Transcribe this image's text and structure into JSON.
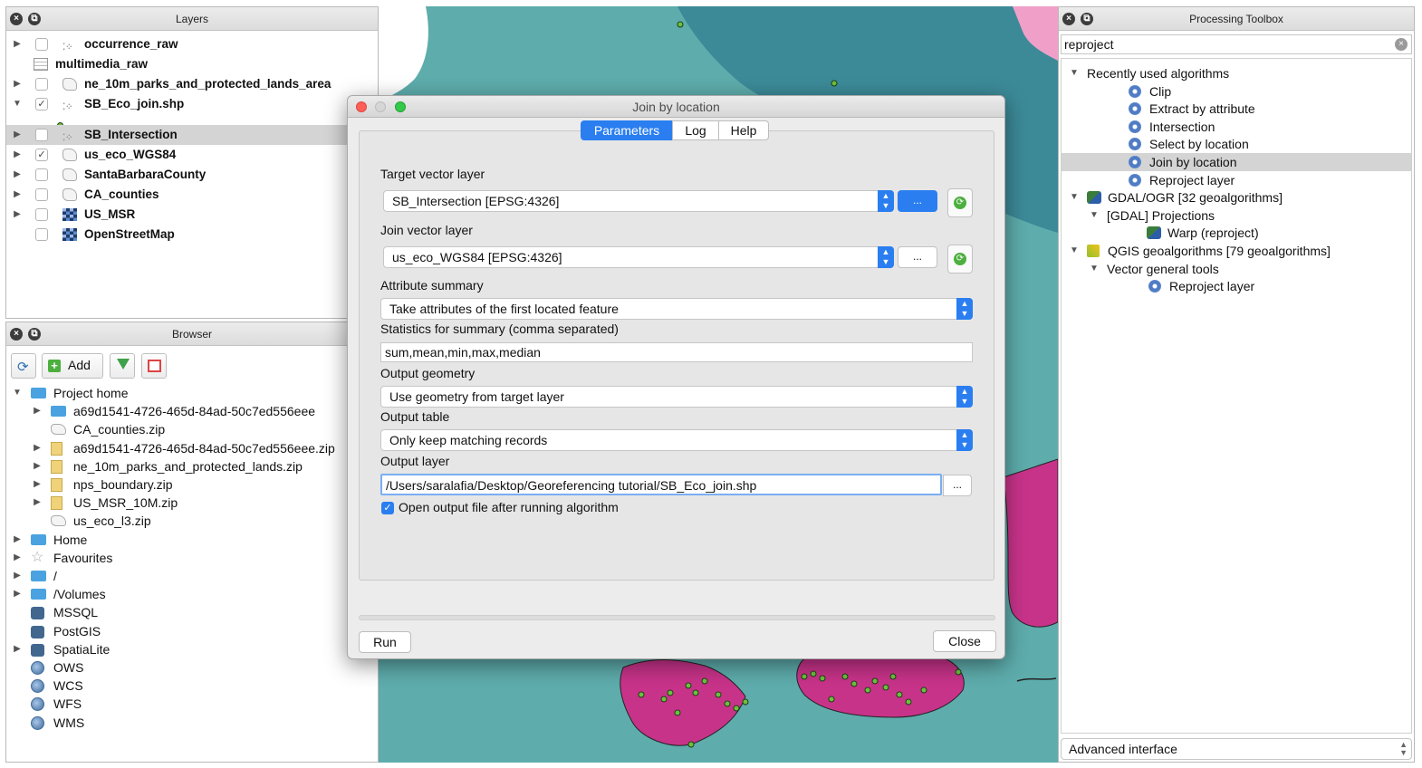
{
  "layers_panel": {
    "title": "Layers",
    "items": [
      {
        "name": "occurrence_raw",
        "checked": false,
        "expander": "▶",
        "icon": "point-layer-icon"
      },
      {
        "name": "multimedia_raw",
        "checked": null,
        "expander": "",
        "icon": "table-layer-icon"
      },
      {
        "name": "ne_10m_parks_and_protected_lands_area",
        "checked": false,
        "expander": "▶",
        "icon": "polygon-layer-icon"
      },
      {
        "name": "SB_Eco_join.shp",
        "checked": true,
        "expander": "▼",
        "icon": "point-layer-icon"
      },
      {
        "name": "SB_Intersection",
        "checked": false,
        "expander": "▶",
        "icon": "point-layer-icon",
        "selected": true
      },
      {
        "name": "us_eco_WGS84",
        "checked": true,
        "expander": "▶",
        "icon": "polygon-layer-icon"
      },
      {
        "name": "SantaBarbaraCounty",
        "checked": false,
        "expander": "▶",
        "icon": "polygon-layer-icon"
      },
      {
        "name": "CA_counties",
        "checked": false,
        "expander": "▶",
        "icon": "polygon-layer-icon"
      },
      {
        "name": "US_MSR",
        "checked": false,
        "expander": "▶",
        "icon": "raster-layer-icon"
      },
      {
        "name": "OpenStreetMap",
        "checked": false,
        "expander": "",
        "icon": "raster-layer-icon"
      }
    ]
  },
  "browser_panel": {
    "title": "Browser",
    "add_label": "Add",
    "items": [
      {
        "label": "Project home",
        "indent": 0,
        "expander": "▼",
        "icon": "folder"
      },
      {
        "label": "a69d1541-4726-465d-84ad-50c7ed556eee",
        "indent": 1,
        "expander": "▶",
        "icon": "folder"
      },
      {
        "label": "CA_counties.zip",
        "indent": 1,
        "expander": "",
        "icon": "polygon"
      },
      {
        "label": "a69d1541-4726-465d-84ad-50c7ed556eee.zip",
        "indent": 1,
        "expander": "▶",
        "icon": "zip"
      },
      {
        "label": "ne_10m_parks_and_protected_lands.zip",
        "indent": 1,
        "expander": "▶",
        "icon": "zip"
      },
      {
        "label": "nps_boundary.zip",
        "indent": 1,
        "expander": "▶",
        "icon": "zip"
      },
      {
        "label": "US_MSR_10M.zip",
        "indent": 1,
        "expander": "▶",
        "icon": "zip"
      },
      {
        "label": "us_eco_l3.zip",
        "indent": 1,
        "expander": "",
        "icon": "polygon"
      },
      {
        "label": "Home",
        "indent": 0,
        "expander": "▶",
        "icon": "folder"
      },
      {
        "label": "Favourites",
        "indent": 0,
        "expander": "▶",
        "icon": "star"
      },
      {
        "label": "/",
        "indent": 0,
        "expander": "▶",
        "icon": "folder"
      },
      {
        "label": "/Volumes",
        "indent": 0,
        "expander": "▶",
        "icon": "folder"
      },
      {
        "label": "MSSQL",
        "indent": 0,
        "expander": "",
        "icon": "db"
      },
      {
        "label": "PostGIS",
        "indent": 0,
        "expander": "",
        "icon": "db"
      },
      {
        "label": "SpatiaLite",
        "indent": 0,
        "expander": "▶",
        "icon": "db"
      },
      {
        "label": "OWS",
        "indent": 0,
        "expander": "",
        "icon": "globe"
      },
      {
        "label": "WCS",
        "indent": 0,
        "expander": "",
        "icon": "globe"
      },
      {
        "label": "WFS",
        "indent": 0,
        "expander": "",
        "icon": "globe"
      },
      {
        "label": "WMS",
        "indent": 0,
        "expander": "",
        "icon": "globe"
      }
    ]
  },
  "dialog": {
    "title": "Join by location",
    "tabs": [
      "Parameters",
      "Log",
      "Help"
    ],
    "active_tab": "Parameters",
    "target_label": "Target vector layer",
    "target_value": "SB_Intersection [EPSG:4326]",
    "join_label": "Join vector layer",
    "join_value": "us_eco_WGS84 [EPSG:4326]",
    "browse_label": "...",
    "attr_label": "Attribute summary",
    "attr_value": "Take attributes of the first located feature",
    "stats_label": "Statistics for summary (comma separated)",
    "stats_value": "sum,mean,min,max,median",
    "geom_label": "Output geometry",
    "geom_value": "Use geometry from target layer",
    "table_label": "Output table",
    "table_value": "Only keep matching records",
    "output_label": "Output layer",
    "output_value": "/Users/saralafia/Desktop/Georeferencing tutorial/SB_Eco_join.shp",
    "open_output_label": "Open output file after running algorithm",
    "open_output_checked": true,
    "run_label": "Run",
    "close_label": "Close"
  },
  "toolbox": {
    "title": "Processing Toolbox",
    "search_value": "reproject",
    "tree": [
      {
        "label": "Recently used algorithms",
        "indent": 0,
        "expander": "▼",
        "icon": ""
      },
      {
        "label": "Clip",
        "indent": 2,
        "expander": "",
        "icon": "gear"
      },
      {
        "label": "Extract by attribute",
        "indent": 2,
        "expander": "",
        "icon": "gear"
      },
      {
        "label": "Intersection",
        "indent": 2,
        "expander": "",
        "icon": "gear"
      },
      {
        "label": "Select by location",
        "indent": 2,
        "expander": "",
        "icon": "gear"
      },
      {
        "label": "Join by location",
        "indent": 2,
        "expander": "",
        "icon": "gear",
        "selected": true
      },
      {
        "label": "Reproject layer",
        "indent": 2,
        "expander": "",
        "icon": "gear"
      },
      {
        "label": "GDAL/OGR [32 geoalgorithms]",
        "indent": 0,
        "expander": "▼",
        "icon": "gdal"
      },
      {
        "label": "[GDAL] Projections",
        "indent": 1,
        "expander": "▼",
        "icon": ""
      },
      {
        "label": "Warp (reproject)",
        "indent": 3,
        "expander": "",
        "icon": "gdal"
      },
      {
        "label": "QGIS geoalgorithms [79 geoalgorithms]",
        "indent": 0,
        "expander": "▼",
        "icon": "qgis"
      },
      {
        "label": "Vector general tools",
        "indent": 1,
        "expander": "▼",
        "icon": ""
      },
      {
        "label": "Reproject layer",
        "indent": 3,
        "expander": "",
        "icon": "gear"
      }
    ],
    "mode_value": "Advanced interface"
  },
  "colors": {
    "map_water": "#5eacac",
    "map_land_dark": "#3c8a98",
    "map_magenta": "#c8338a",
    "accent_blue": "#2a7ef0",
    "selection_gray": "#d4d4d4"
  }
}
